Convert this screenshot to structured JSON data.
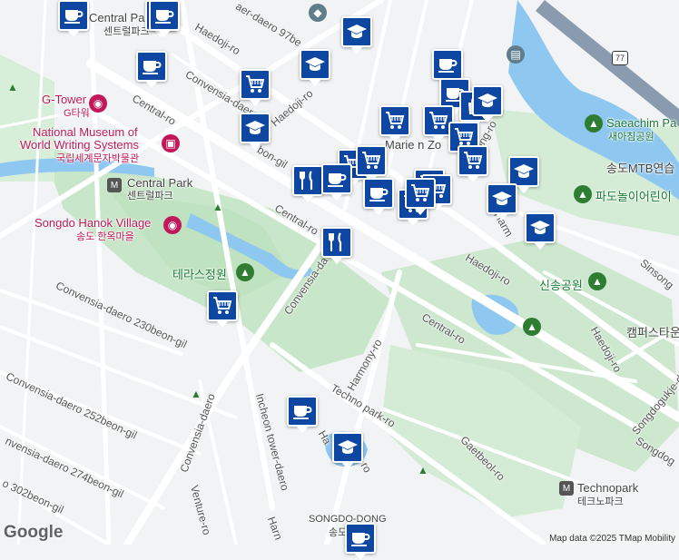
{
  "map": {
    "roads": {
      "central_ro_1": "Central-ro",
      "central_ro_2": "Central-ro",
      "central_ro_3": "Central-ro",
      "convensia_daero": "Convensia-daero",
      "convensia_daero_t": "Convensia-daero T",
      "convensia_daero_d": "Convensia-da",
      "convensia_daero_s": "Convensia-daero",
      "bon_gil": "bon-gil",
      "haedoji_1": "Haedoji-ro",
      "haedoji_2": "Haedoji-ro",
      "haedoji_3": "Haedoji-ro",
      "haedoji_4": "Haedoji-ro",
      "haedoji_5": "Haedoji-ro",
      "daero_97": "aer-daero 97be",
      "conv_230": "Convensia-daero 230beon-gil",
      "conv_252": "Convensia-daero 252beon-gil",
      "conv_274": "nvensia-daero 274beon-gil",
      "conv_302": "o 302beon-gil",
      "harmony_1": "Harmony-ro",
      "harmony_2": "Harm",
      "harmony_3": "Ha",
      "harmony_4": "ro",
      "harmony_5": "Harn",
      "techno_park_ro": "Techno park-ro",
      "gaetbeol_ro": "Gaetbeol-ro",
      "incheon_tower": "Incheon tower-daero",
      "venture_ro": "Venture-ro",
      "sinsong": "Sinsong",
      "songdogukje": "Songdogukje-daero",
      "songdog": "Songdog",
      "mong_ro": "ong-ro"
    },
    "places": {
      "central_park_top": "Central Park",
      "central_park_top_ko": "센트럴파크",
      "g_tower": "G-Tower",
      "g_tower_ko": "G타워",
      "museum_1": "National Museum of",
      "museum_2": "World Writing Systems",
      "museum_ko": "국립세계문자박물관",
      "central_park_station": "Central Park",
      "central_park_station_ko": "센트럴파크",
      "hanok_village": "Songdo Hanok Village",
      "hanok_ko": "송도 한옥마을",
      "terrace_garden": "테라스정원",
      "saeachim_park": "Saeachim Pa",
      "saeachim_ko": "새아침공원",
      "mtb": "송도MTB연습",
      "padoplay": "파도놀이어린이",
      "sinsong_park": "신송공원",
      "campus_town": "캠퍼스타운",
      "technopark": "Technopark",
      "technopark_ko": "테크노파크",
      "songdo_dong": "SONGDO-DONG",
      "songdo_dong_ko": "송도",
      "marie": "Marie n Zo"
    },
    "route_badge": "77"
  },
  "poi_markers": [
    {
      "kind": "cup"
    },
    {
      "kind": "cup"
    },
    {
      "kind": "cart"
    },
    {
      "kind": "cup"
    },
    {
      "kind": "grad"
    },
    {
      "kind": "grad"
    },
    {
      "kind": "grad"
    },
    {
      "kind": "cup"
    },
    {
      "kind": "cup"
    },
    {
      "kind": "cart"
    },
    {
      "kind": "bag"
    },
    {
      "kind": "cart"
    },
    {
      "kind": "cart"
    },
    {
      "kind": "cart"
    },
    {
      "kind": "cart"
    },
    {
      "kind": "cart"
    },
    {
      "kind": "cart"
    },
    {
      "kind": "fork"
    },
    {
      "kind": "cup"
    },
    {
      "kind": "cup"
    },
    {
      "kind": "cart"
    },
    {
      "kind": "cart"
    },
    {
      "kind": "cart"
    },
    {
      "kind": "grad"
    },
    {
      "kind": "grad"
    },
    {
      "kind": "grad"
    },
    {
      "kind": "grad"
    },
    {
      "kind": "fork"
    },
    {
      "kind": "cart"
    },
    {
      "kind": "cup"
    },
    {
      "kind": "grad"
    },
    {
      "kind": "cup"
    },
    {
      "kind": "cup"
    }
  ],
  "footer": {
    "brand": "Google",
    "attribution": "Map data ©2025 TMap Mobility"
  },
  "colors": {
    "background": "#f1f3f4",
    "park": "#c8e6c9",
    "water": "#8ec7f0",
    "road": "#ffffff",
    "marker": "#0d47a1"
  }
}
